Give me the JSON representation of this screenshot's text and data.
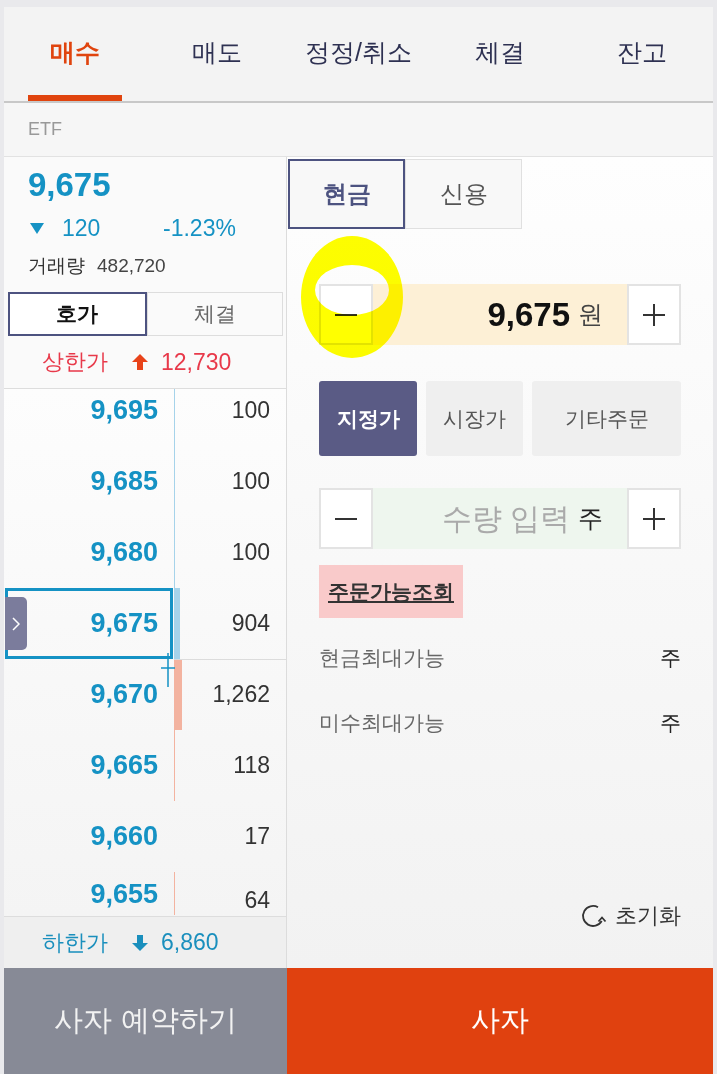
{
  "tabs": [
    {
      "label": "매수",
      "selected": true
    },
    {
      "label": "매도",
      "selected": false
    },
    {
      "label": "정정/취소",
      "selected": false
    },
    {
      "label": "체결",
      "selected": false
    },
    {
      "label": "잔고",
      "selected": false
    }
  ],
  "instrument": {
    "type": "ETF"
  },
  "quote": {
    "price": "9,675",
    "falling": true,
    "change": "120",
    "change_rate": "-1.23%",
    "volume_label": "거래량",
    "volume": "482,720"
  },
  "book_tabs": [
    {
      "label": "호가",
      "selected": true
    },
    {
      "label": "체결",
      "selected": false
    }
  ],
  "upper_limit": {
    "label": "상한가",
    "value": "12,730"
  },
  "order_book": [
    {
      "price": "9,695",
      "quantity": "100",
      "kind": "ask",
      "selected": false
    },
    {
      "price": "9,685",
      "quantity": "100",
      "kind": "ask",
      "selected": false
    },
    {
      "price": "9,680",
      "quantity": "100",
      "kind": "ask",
      "selected": false
    },
    {
      "price": "9,675",
      "quantity": "904",
      "kind": "ask",
      "selected": true
    },
    {
      "price": "9,670",
      "quantity": "1,262",
      "kind": "bid",
      "selected": false
    },
    {
      "price": "9,665",
      "quantity": "118",
      "kind": "bid",
      "selected": false
    },
    {
      "price": "9,660",
      "quantity": "17",
      "kind": "bid",
      "selected": false
    },
    {
      "price": "9,655",
      "quantity": "64",
      "kind": "bid",
      "selected": false
    }
  ],
  "lower_limit": {
    "label": "하한가",
    "value": "6,860"
  },
  "account_tabs": [
    {
      "label": "현금",
      "selected": true
    },
    {
      "label": "신용",
      "selected": false
    }
  ],
  "price_input": {
    "value": "9,675",
    "unit": "원",
    "circled": true
  },
  "order_types": [
    {
      "label": "지정가",
      "selected": true
    },
    {
      "label": "시장가",
      "selected": false
    },
    {
      "label": "기타주문",
      "selected": false
    }
  ],
  "quantity_input": {
    "placeholder": "수량 입력",
    "unit": "주"
  },
  "availability_button": {
    "label": "주문가능조회"
  },
  "limits": [
    {
      "label": "현금최대가능",
      "unit": "주"
    },
    {
      "label": "미수최대가능",
      "unit": "주"
    }
  ],
  "reset_button": {
    "label": "초기화"
  },
  "actions": [
    {
      "label": "사자 예약하기",
      "kind": "secondary"
    },
    {
      "label": "사자",
      "kind": "primary"
    }
  ]
}
